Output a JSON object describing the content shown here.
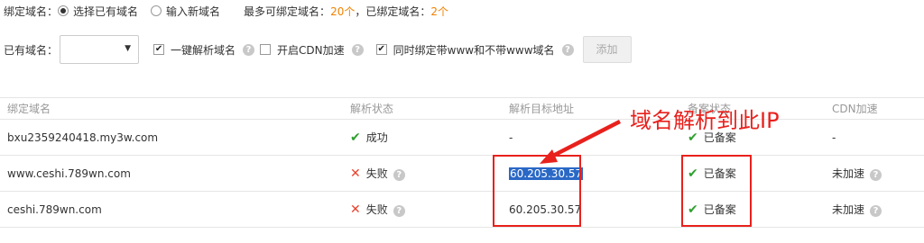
{
  "bind_domain": {
    "label": "绑定域名：",
    "opt_existing": "选择已有域名",
    "opt_new": "输入新域名",
    "max_prefix": "最多可绑定域名：",
    "max_value": "20个",
    "bound_prefix": "，已绑定域名：",
    "bound_value": "2个"
  },
  "form": {
    "existing_label": "已有域名：",
    "select_value": "",
    "cb_one_click": "一键解析域名",
    "cb_cdn": "开启CDN加速",
    "cb_www": "同时绑定带www和不带www域名",
    "add_label": "添加"
  },
  "table": {
    "headers": [
      "绑定域名",
      "解析状态",
      "解析目标地址",
      "备案状态",
      "CDN加速"
    ],
    "rows": [
      {
        "domain": "bxu2359240418.my3w.com",
        "status": "成功",
        "target": "-",
        "beian": "已备案",
        "cdn": "-"
      },
      {
        "domain": "www.ceshi.789wn.com",
        "status": "失败",
        "target": "60.205.30.57",
        "beian": "已备案",
        "cdn": "未加速"
      },
      {
        "domain": "ceshi.789wn.com",
        "status": "失败",
        "target": "60.205.30.57",
        "beian": "已备案",
        "cdn": "未加速"
      }
    ]
  },
  "annotation": {
    "text": "域名解析到此IP",
    "color": "#e8211d"
  }
}
